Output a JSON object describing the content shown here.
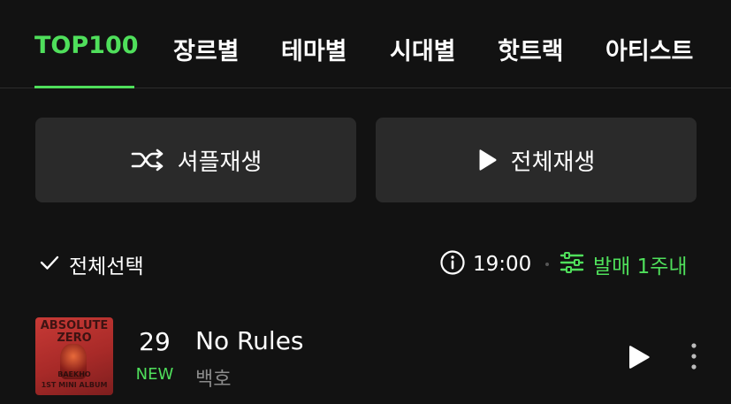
{
  "tabs": [
    {
      "label": "TOP100",
      "active": true
    },
    {
      "label": "장르별",
      "active": false
    },
    {
      "label": "테마별",
      "active": false
    },
    {
      "label": "시대별",
      "active": false
    },
    {
      "label": "핫트랙",
      "active": false
    },
    {
      "label": "아티스트",
      "active": false
    }
  ],
  "actions": {
    "shuffle_label": "셔플재생",
    "shuffle_icon": "shuffle-icon",
    "play_all_label": "전체재생",
    "play_all_icon": "play-icon"
  },
  "controls": {
    "select_all_label": "전체선택",
    "select_all_icon": "checkmark-icon",
    "info_icon": "info-icon",
    "time": "19:00",
    "filter_icon": "sliders-icon",
    "filter_label": "발매 1주내"
  },
  "songs": [
    {
      "rank": "29",
      "change": "NEW",
      "title": "No Rules",
      "artist": "백호",
      "album_art_text": [
        "ABSOLUTE",
        "ZERO",
        "BAEKHO",
        "1ST MINI ALBUM"
      ]
    }
  ],
  "colors": {
    "background": "#121212",
    "accent": "#4fdf5b",
    "button_bg": "#2a2a2a",
    "muted_text": "#8a8a8a"
  }
}
